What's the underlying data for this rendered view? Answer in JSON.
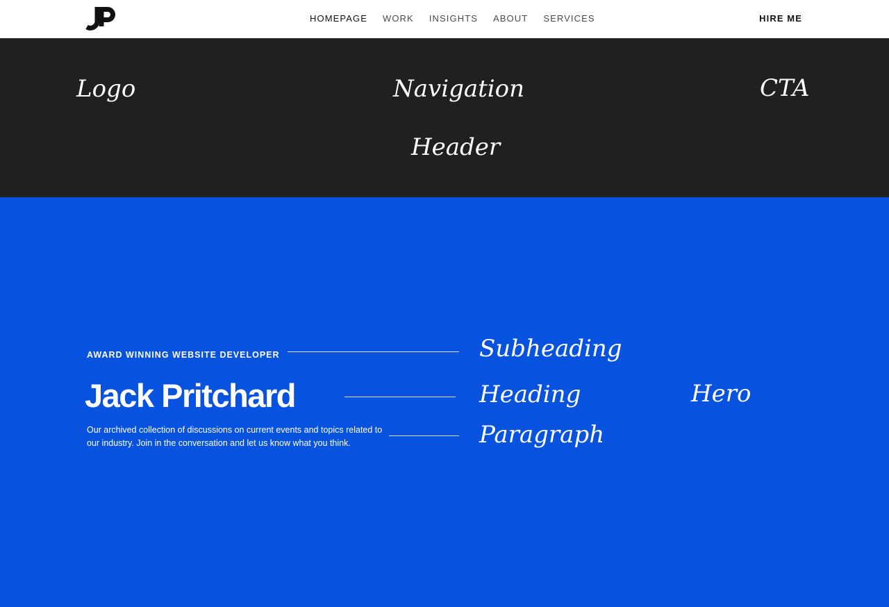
{
  "navbar": {
    "logo_text": "JP",
    "links": [
      {
        "label": "HOMEPAGE",
        "active": true
      },
      {
        "label": "WORK",
        "active": false
      },
      {
        "label": "INSIGHTS",
        "active": false
      },
      {
        "label": "ABOUT",
        "active": false
      },
      {
        "label": "SERVICES",
        "active": false
      }
    ],
    "cta_label": "HIRE ME"
  },
  "annotations": {
    "logo": "Logo",
    "navigation": "Navigation",
    "cta": "CTA",
    "header": "Header",
    "subheading": "Subheading",
    "heading": "Heading",
    "paragraph": "Paragraph",
    "hero": "Hero"
  },
  "hero": {
    "subheading": "AWARD WINNING WEBSITE DEVELOPER",
    "heading": "Jack Pritchard",
    "paragraph": "Our archived collection of discussions on current events and topics related to our industry. Join in the conversation and let us know what you think."
  },
  "colors": {
    "navbar_bg": "#ffffff",
    "header_band_bg": "#212021",
    "hero_bg": "#0753e0",
    "text_dark": "#111111",
    "text_light": "#ffffff"
  }
}
